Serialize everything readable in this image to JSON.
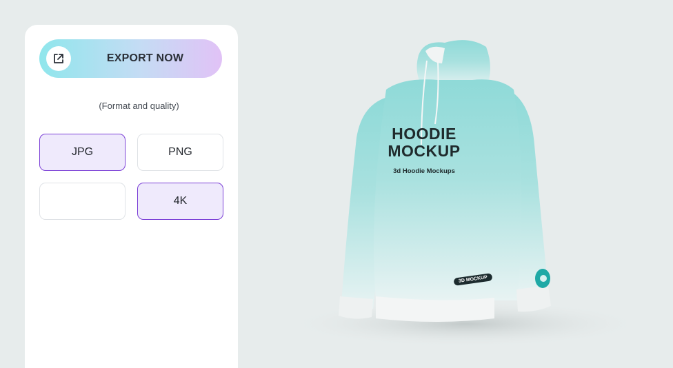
{
  "export": {
    "label": "EXPORT NOW",
    "icon": "external-link-icon"
  },
  "format_section": {
    "subtitle": "(Format and quality)"
  },
  "options": [
    {
      "label": "JPG",
      "selected": true
    },
    {
      "label": "PNG",
      "selected": false
    },
    {
      "label": "",
      "selected": false
    },
    {
      "label": "4K",
      "selected": true
    }
  ],
  "product": {
    "title_line1": "HOODIE",
    "title_line2": "MOCKUP",
    "subtitle": "3d Hoodie Mockups",
    "badge": "3D MOCKUP"
  },
  "colors": {
    "accent": "#7b3fd6",
    "hoodie_top": "#8fdad8",
    "hoodie_bottom": "#e8f3f3",
    "background": "#e7ecec"
  }
}
